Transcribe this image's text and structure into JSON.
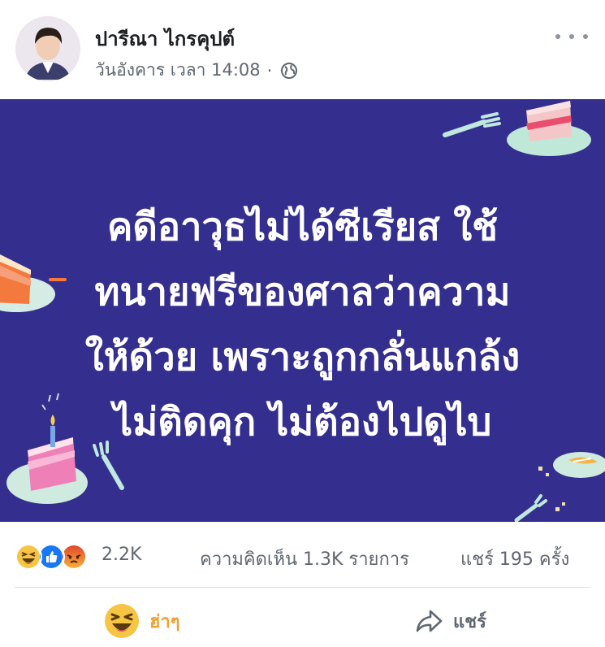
{
  "post": {
    "author": "ปารีณา ไกรคุปต์",
    "timestamp": "วันอังคาร เวลา 14:08",
    "separator": "·",
    "privacy_icon": "globe-icon",
    "more_icon": "more-options-icon"
  },
  "image": {
    "background_color": "#342e8e",
    "headline_lines": [
      "คดีอาวุธไม่ได้ซีเรียส ใช้",
      "ทนายฟรีของศาลว่าความ",
      "ให้ด้วย เพราะถูกกลั่นแกล้ง",
      "ไม่ติดคุก ไม่ต้องไปดูไบ"
    ]
  },
  "stats": {
    "reaction_icons": [
      "haha-icon",
      "like-icon",
      "angry-icon"
    ],
    "reaction_count": "2.2K",
    "comments": "ความคิดเห็น 1.3K รายการ",
    "shares": "แชร์ 195 ครั้ง"
  },
  "actions": {
    "reaction_label": "ฮ่าๆ",
    "reaction_color": "#f0a030",
    "share_label": "แชร์"
  }
}
